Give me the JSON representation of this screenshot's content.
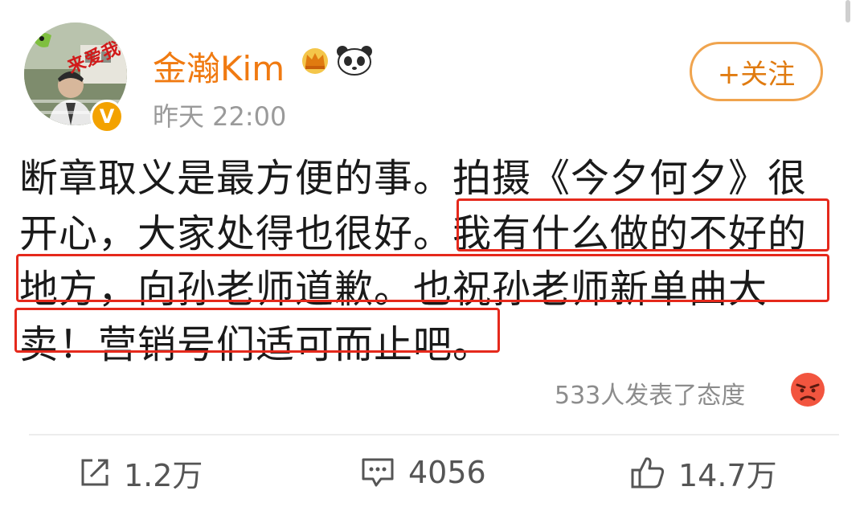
{
  "user": {
    "name": "金瀚Kim",
    "timestamp": "昨天 22:00",
    "avatar_sticker": "来爱我"
  },
  "follow_button": {
    "label": "+关注"
  },
  "post": {
    "lines": [
      "断章取义是最方便的事。拍摄《今夕何夕》很",
      "开心，大家处得也很好。我有什么做的不好的",
      "地方，向孙老师道歉。也祝孙老师新单曲大",
      "卖！营销号们适可而止吧。"
    ]
  },
  "reactions": {
    "summary": "533人发表了态度",
    "emoji": "angry-face-icon"
  },
  "actions": {
    "share": "1.2万",
    "comment": "4056",
    "like": "14.7万"
  },
  "colors": {
    "username": "#f07a11",
    "follow_border": "#f0a44e",
    "highlight_box": "#e5291c",
    "verified_badge": "#f3a200"
  }
}
